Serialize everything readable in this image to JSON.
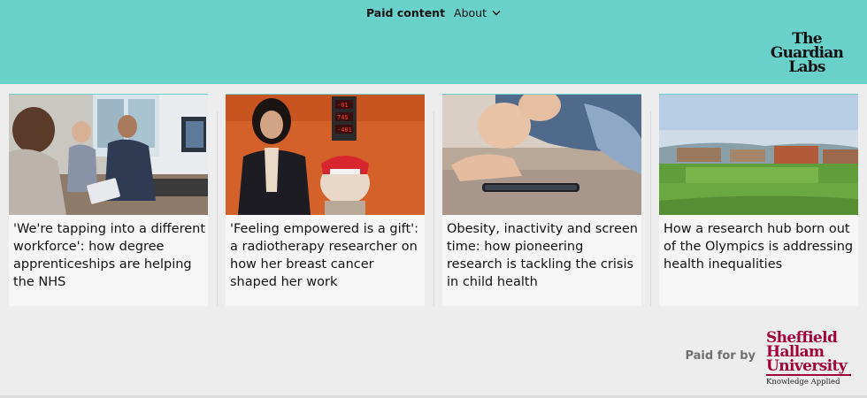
{
  "header": {
    "paid_content_label": "Paid content",
    "about_label": "About",
    "logo_lines": [
      "The",
      "Guardian",
      "Labs"
    ],
    "bg_color": "#69d1ca"
  },
  "cards": [
    {
      "title": "'We're tapping into a different workforce': how degree apprenticeships are helping the NHS",
      "image": "nurses-with-tablet-photo"
    },
    {
      "title": "'Feeling empowered is a gift': a radiotherapy researcher on how her breast cancer shaped her work",
      "image": "researcher-with-radiotherapy-model-photo"
    },
    {
      "title": "Obesity, inactivity and screen time: how pioneering research is tackling the crisis in child health",
      "image": "child-with-phone-photo"
    },
    {
      "title": "How a research hub born out of the Olympics is addressing health inequalities",
      "image": "city-sports-ground-photo"
    }
  ],
  "footer": {
    "paid_for_label": "Paid for by",
    "sponsor_lines": [
      "Sheffield",
      "Hallam",
      "University"
    ],
    "sponsor_tagline": "Knowledge Applied",
    "sponsor_color": "#a3003a"
  }
}
